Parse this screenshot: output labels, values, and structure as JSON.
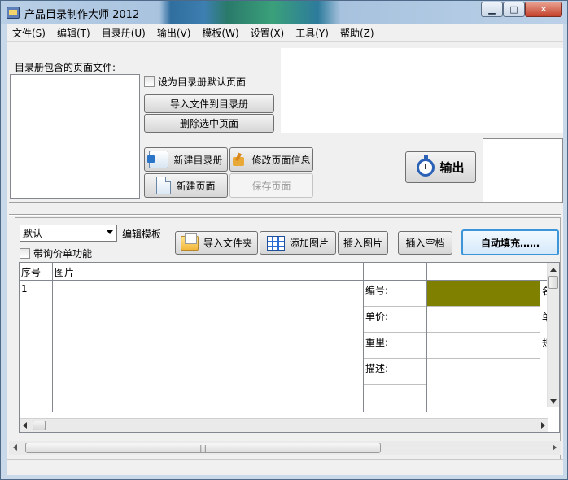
{
  "window": {
    "title": "产品目录制作大师 2012",
    "min": "▁",
    "max": "□",
    "close": "✕"
  },
  "menu": [
    "文件(S)",
    "编辑(T)",
    "目录册(U)",
    "输出(V)",
    "模板(W)",
    "设置(X)",
    "工具(Y)",
    "帮助(Z)"
  ],
  "catalog": {
    "pages_label": "目录册包含的页面文件:",
    "default_page_checkbox": "设为目录册默认页面",
    "import_button": "导入文件到目录册",
    "delete_button": "删除选中页面",
    "new_catalog_button": "新建目录册",
    "edit_page_info_button": "修改页面信息",
    "new_page_button": "新建页面",
    "save_page_button": "保存页面",
    "output_button": "输出"
  },
  "template": {
    "selected": "默认",
    "edit_label": "编辑模板",
    "inquiry_checkbox": "带询价单功能",
    "import_folder_button": "导入文件夹",
    "add_image_button": "添加图片",
    "insert_image_button": "插入图片",
    "insert_blank_button": "插入空档",
    "autofill_button": "自动填充……"
  },
  "grid": {
    "headers": {
      "index": "序号",
      "image": "图片"
    },
    "row": {
      "index": "1",
      "fields": [
        "编号:",
        "单价:",
        "重里:",
        "描述:"
      ],
      "partial_text": [
        "名",
        "单",
        "规"
      ]
    },
    "color_swatch": "#808000"
  },
  "scroll": {
    "grip": "|||"
  }
}
